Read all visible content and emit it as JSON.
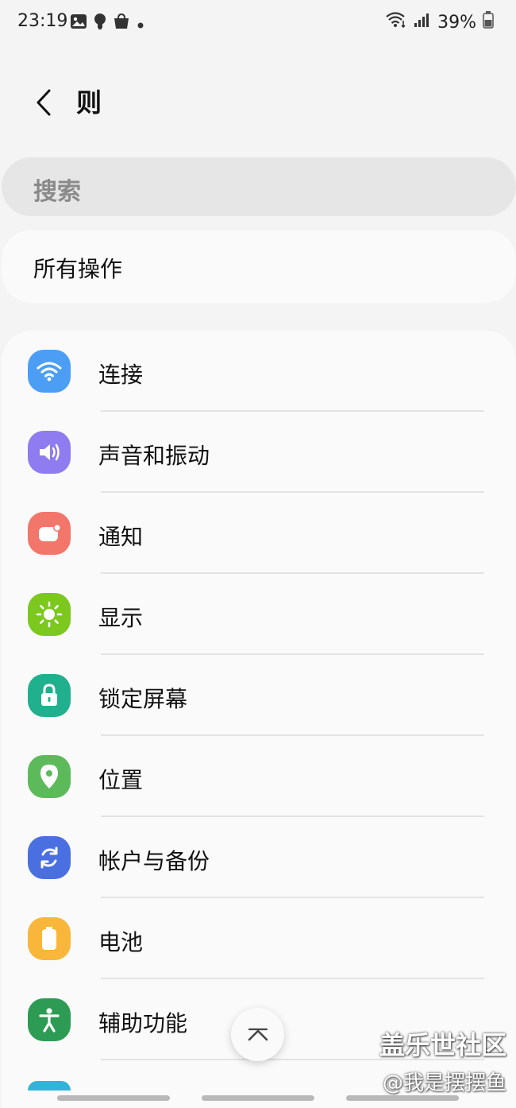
{
  "status_bar": {
    "time": "23:19",
    "battery": "39%",
    "left_icons": [
      "gallery-icon",
      "lightbulb-icon",
      "shopping-bag-icon",
      "dot-icon"
    ],
    "right_icons": [
      "wifi-icon",
      "signal-icon",
      "battery-icon"
    ]
  },
  "header": {
    "title": "则",
    "back_icon": "chevron-left-icon"
  },
  "search": {
    "placeholder": "搜索"
  },
  "all_actions": {
    "label": "所有操作"
  },
  "settings": {
    "items": [
      {
        "label": "连接",
        "icon": "wifi-icon",
        "color": "#4c9ef5"
      },
      {
        "label": "声音和振动",
        "icon": "speaker-icon",
        "color": "#8e7cf0"
      },
      {
        "label": "通知",
        "icon": "notification-icon",
        "color": "#f2766a"
      },
      {
        "label": "显示",
        "icon": "sun-icon",
        "color": "#7cc81f"
      },
      {
        "label": "锁定屏幕",
        "icon": "lock-icon",
        "color": "#21b08d"
      },
      {
        "label": "位置",
        "icon": "location-pin-icon",
        "color": "#5dba5b"
      },
      {
        "label": "帐户与备份",
        "icon": "sync-icon",
        "color": "#4a6fe0"
      },
      {
        "label": "电池",
        "icon": "battery-icon",
        "color": "#f8b73a"
      },
      {
        "label": "辅助功能",
        "icon": "accessibility-icon",
        "color": "#2e9b54"
      }
    ]
  },
  "scroll_top": {
    "icon": "chevron-up-icon"
  },
  "watermark": {
    "line1": "盖乐世社区",
    "line2": "@我是摆摆鱼"
  }
}
